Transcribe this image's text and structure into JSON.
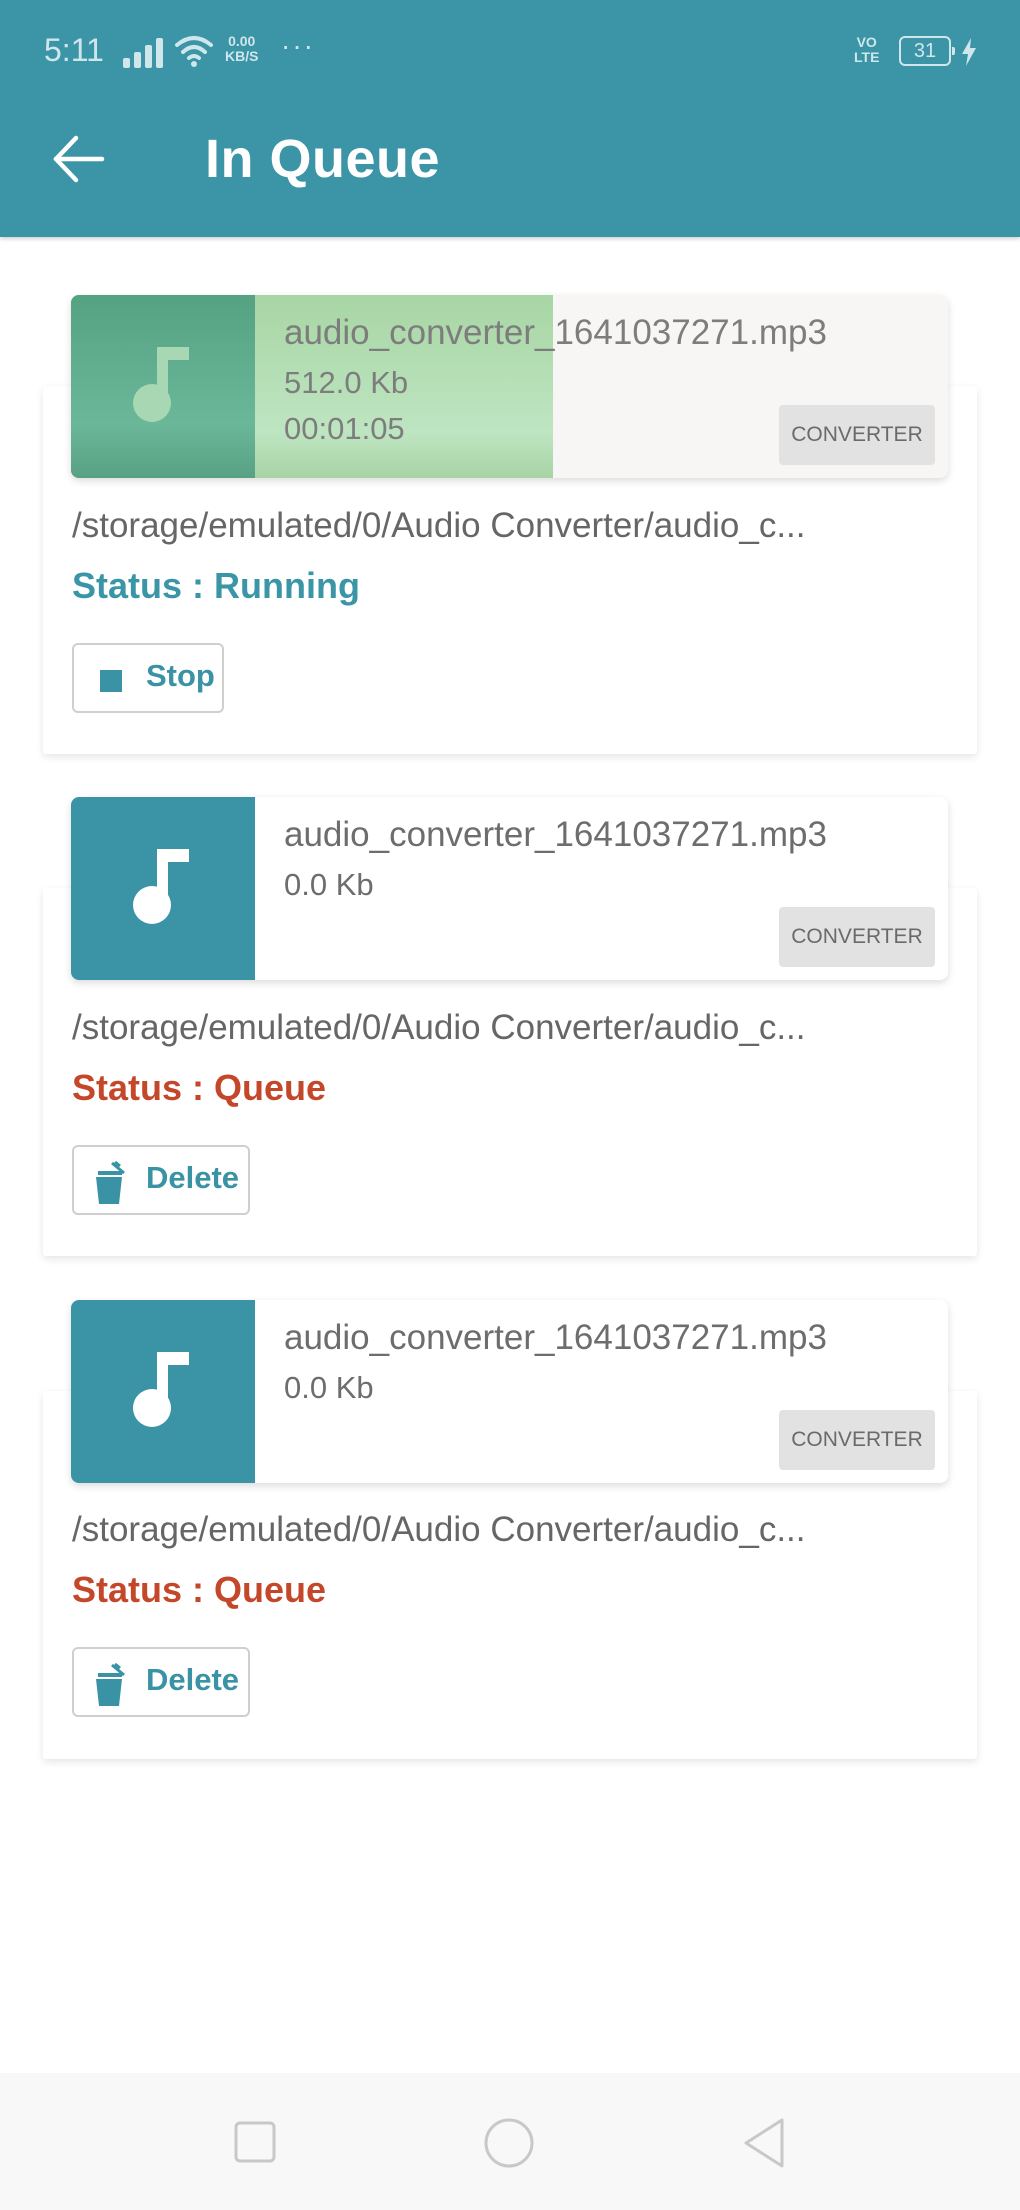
{
  "status_bar": {
    "time": "5:11",
    "net_speed_value": "0.00",
    "net_speed_unit": "KB/S",
    "more": "···",
    "volte_top": "VO",
    "volte_bottom": "LTE",
    "battery_level": "31",
    "icons": [
      "signal-icon",
      "wifi-icon",
      "battery-icon",
      "charging-icon"
    ]
  },
  "app_bar": {
    "back_icon": "arrow-left-icon",
    "title": "In Queue"
  },
  "colors": {
    "primary": "#3c95a7",
    "status_running": "#3a95a6",
    "status_queue": "#c4472a",
    "progress_fill": "#a3d0a4"
  },
  "queue": [
    {
      "file_name": "audio_converter_1641037271.mp3",
      "file_size": "512.0 Kb",
      "duration": "00:01:05",
      "tag": "CONVERTER",
      "path": "/storage/emulated/0/Audio Converter/audio_c...",
      "status": "Status : Running",
      "state": "running",
      "progress_percent": 55,
      "action_label": "Stop",
      "action_icon": "stop-icon"
    },
    {
      "file_name": "audio_converter_1641037271.mp3",
      "file_size": "0.0 Kb",
      "tag": "CONVERTER",
      "path": "/storage/emulated/0/Audio Converter/audio_c...",
      "status": "Status : Queue",
      "state": "queue",
      "action_label": "Delete",
      "action_icon": "trash-icon"
    },
    {
      "file_name": "audio_converter_1641037271.mp3",
      "file_size": "0.0 Kb",
      "tag": "CONVERTER",
      "path": "/storage/emulated/0/Audio Converter/audio_c...",
      "status": "Status : Queue",
      "state": "queue",
      "action_label": "Delete",
      "action_icon": "trash-icon"
    }
  ],
  "nav_bar": {
    "buttons": [
      "recents-icon",
      "home-icon",
      "back-icon"
    ]
  }
}
